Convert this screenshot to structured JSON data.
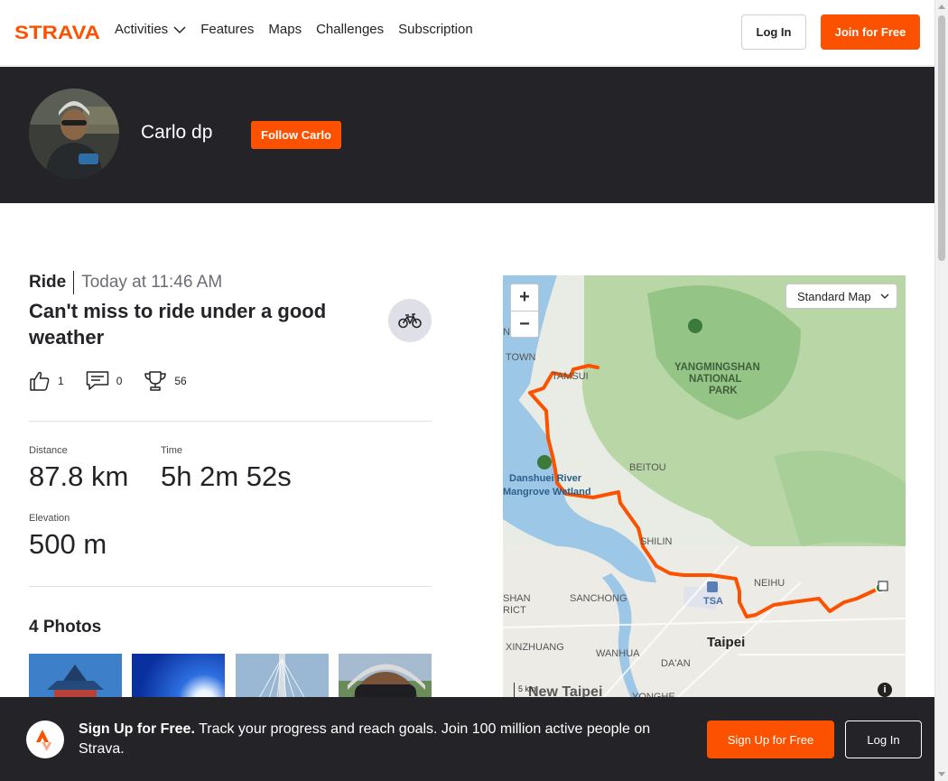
{
  "nav": {
    "brand": "STRAVA",
    "links": [
      {
        "label": "Activities"
      },
      {
        "label": "Features"
      },
      {
        "label": "Maps"
      },
      {
        "label": "Challenges"
      },
      {
        "label": "Subscription"
      }
    ],
    "login_label": "Log In",
    "join_label": "Join for Free"
  },
  "athlete": {
    "name": "Carlo dp",
    "follow_label": "Follow Carlo"
  },
  "activity": {
    "type": "Ride",
    "datetime": "Today at 11:46 AM",
    "title": "Can't miss to ride under a good weather",
    "kudos": "1",
    "comments": "0",
    "achievements": "56",
    "stats": {
      "distance_label": "Distance",
      "distance_value": "87.8 km",
      "time_label": "Time",
      "time_value": "5h 2m 52s",
      "elevation_label": "Elevation",
      "elevation_value": "500 m"
    },
    "photos_title": "4 Photos"
  },
  "map": {
    "style_selected": "Standard Map",
    "scale_label": "5 km",
    "labels": {
      "tamsui": "TAMSUI",
      "yangmingshan": "YANGMINGSHAN",
      "national": "NATIONAL",
      "park": "PARK",
      "beitou": "BEITOU",
      "danshuei": "Danshuei River",
      "mangrove": "Mangrove Wetland",
      "shilin": "SHILIN",
      "neihu": "NEIHU",
      "sanchong": "SANCHONG",
      "tsa": "TSA",
      "taipei": "Taipei",
      "xinzhuang": "XINZHUANG",
      "wanhua": "WANHUA",
      "daan": "DA'AN",
      "yonghe": "YONGHE",
      "new_taipei": "New Taipei",
      "town": "TOWN",
      "nhai": "NHAI",
      "shan": "SHAN",
      "rict": "RICT"
    },
    "route_color": "#fc5200"
  },
  "signup": {
    "bold": "Sign Up for Free.",
    "text": " Track your progress and reach goals. Join 100 million active people on Strava.",
    "signup_label": "Sign Up for Free",
    "login_label": "Log In"
  },
  "colors": {
    "brand": "#fc5200",
    "dark": "#242428"
  }
}
